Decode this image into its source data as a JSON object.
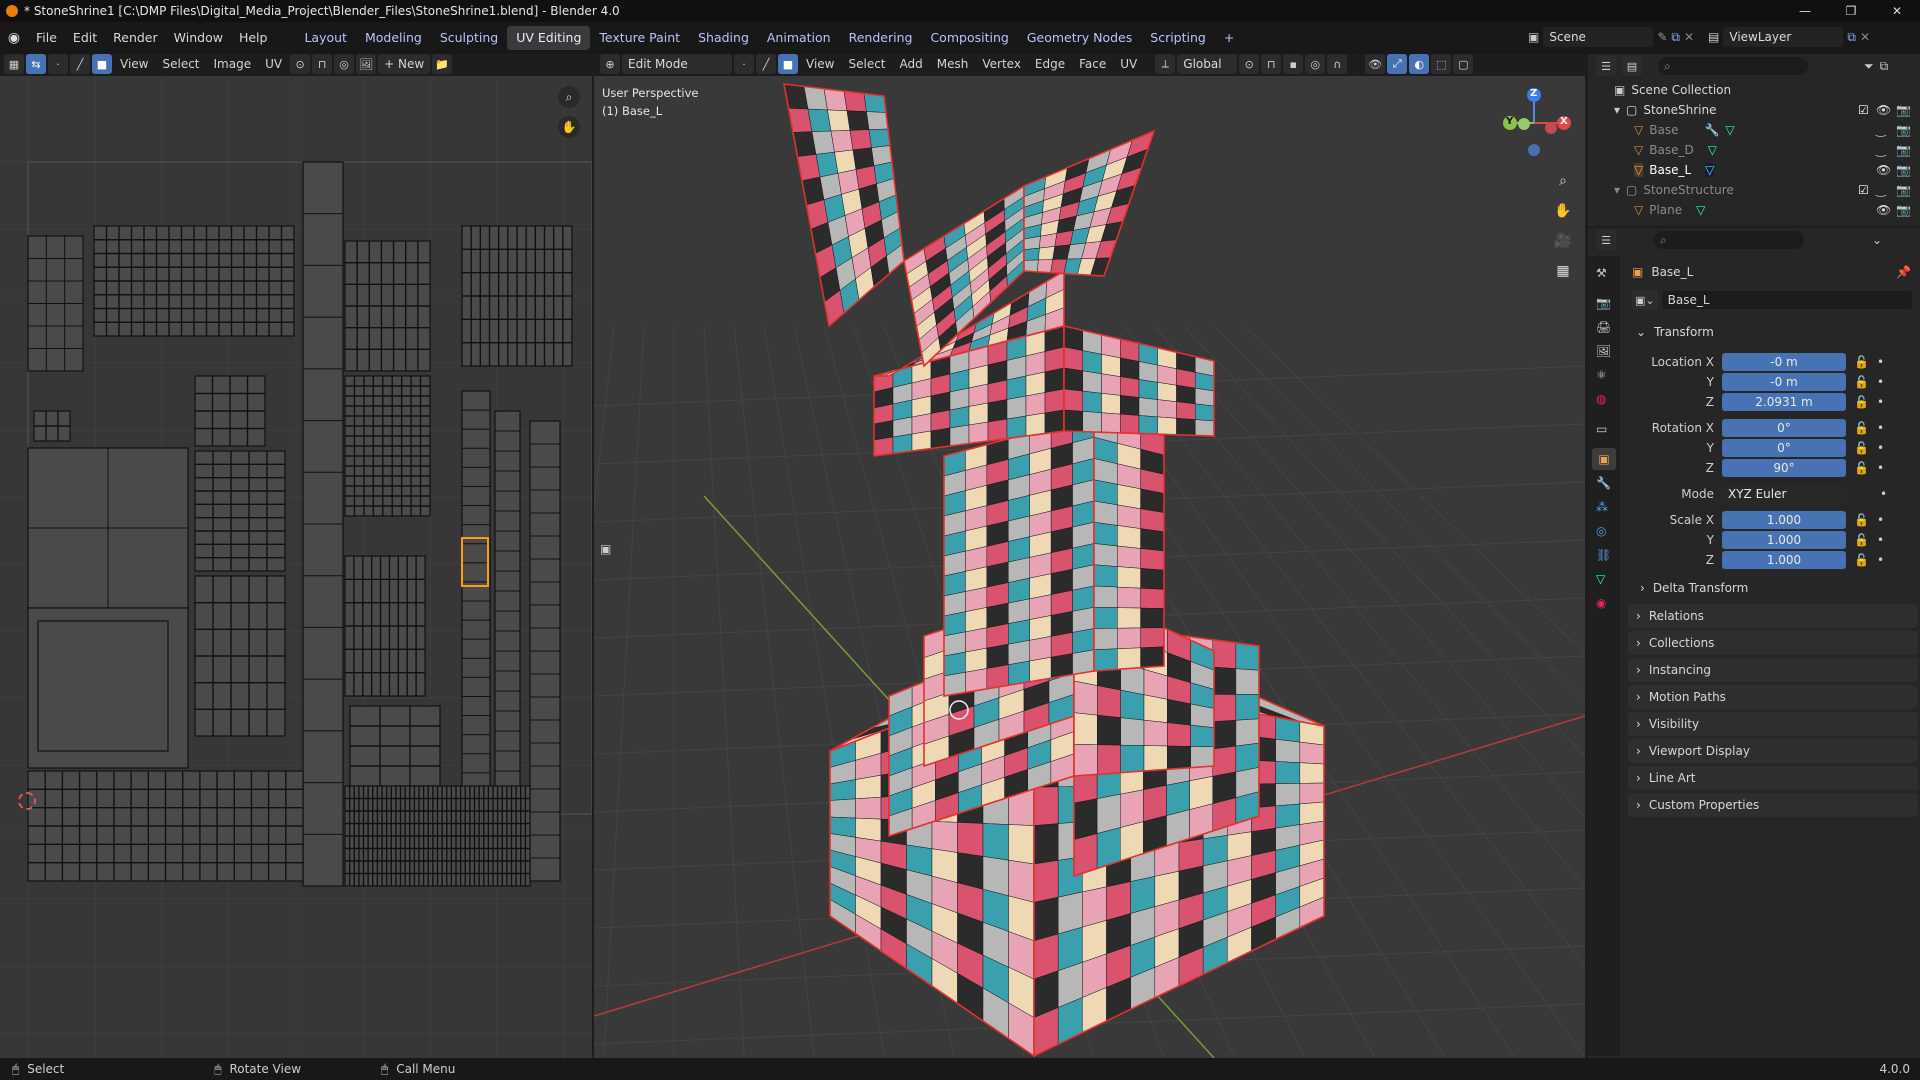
{
  "window": {
    "title": "* StoneShrine1 [C:\\DMP Files\\Digital_Media_Project\\Blender_Files\\StoneShrine1.blend] - Blender 4.0",
    "controls": [
      "—",
      "❐",
      "✕"
    ]
  },
  "menu": {
    "items": [
      "File",
      "Edit",
      "Render",
      "Window",
      "Help"
    ],
    "workspaces": [
      "Layout",
      "Modeling",
      "Sculpting",
      "UV Editing",
      "Texture Paint",
      "Shading",
      "Animation",
      "Rendering",
      "Compositing",
      "Geometry Nodes",
      "Scripting"
    ],
    "active_workspace": "UV Editing",
    "add_tab": "+",
    "scene": "Scene",
    "view_layer": "ViewLayer"
  },
  "uv_editor": {
    "menus": [
      "View",
      "Select",
      "Image",
      "UV"
    ],
    "new_button": "New"
  },
  "viewport": {
    "mode": "Edit Mode",
    "menus": [
      "View",
      "Select",
      "Add",
      "Mesh",
      "Vertex",
      "Edge",
      "Face",
      "UV"
    ],
    "transform_orientation": "Global",
    "overlay_line1": "User Perspective",
    "overlay_line2": "(1) Base_L",
    "gizmo": {
      "x": "X",
      "y": "Y",
      "z": "Z"
    }
  },
  "outliner": {
    "collection_root": "Scene Collection",
    "items": [
      {
        "label": "StoneShrine",
        "level": 1
      },
      {
        "label": "Base",
        "level": 2
      },
      {
        "label": "Base_D",
        "level": 2
      },
      {
        "label": "Base_L",
        "level": 2
      },
      {
        "label": "StoneStructure",
        "level": 1
      },
      {
        "label": "Plane",
        "level": 2
      }
    ]
  },
  "properties": {
    "object_name": "Base_L",
    "datablock_name": "Base_L",
    "transform_header": "Transform",
    "location": {
      "label": "Location X",
      "y_label": "Y",
      "z_label": "Z",
      "x": "-0 m",
      "y": "-0 m",
      "z": "2.0931 m"
    },
    "rotation": {
      "label": "Rotation X",
      "y_label": "Y",
      "z_label": "Z",
      "x": "0°",
      "y": "0°",
      "z": "90°"
    },
    "mode_label": "Mode",
    "mode_value": "XYZ Euler",
    "scale": {
      "label": "Scale X",
      "y_label": "Y",
      "z_label": "Z",
      "x": "1.000",
      "y": "1.000",
      "z": "1.000"
    },
    "delta_transform": "Delta Transform",
    "panels": [
      "Relations",
      "Collections",
      "Instancing",
      "Motion Paths",
      "Visibility",
      "Viewport Display",
      "Line Art",
      "Custom Properties"
    ]
  },
  "status": {
    "select": "Select",
    "rotate": "Rotate View",
    "call_menu": "Call Menu",
    "version": "4.0.0"
  },
  "colors": {
    "accent": "#4772b3",
    "selection_outline": "#e0322f",
    "texture_pink": "#d9536f",
    "texture_teal": "#3aa0ae",
    "texture_cream": "#efd9b4",
    "texture_dark": "#2b2b2b"
  }
}
